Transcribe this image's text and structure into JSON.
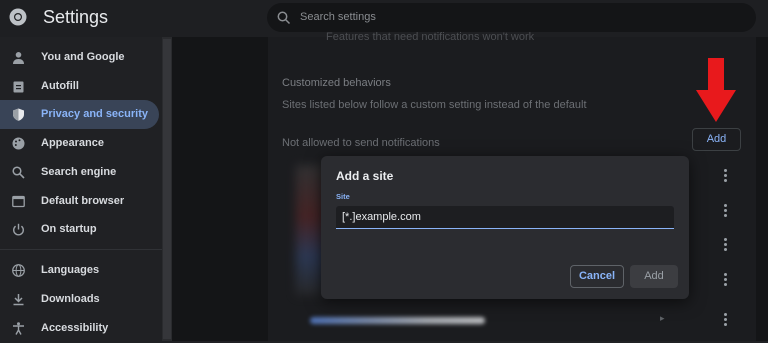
{
  "app": {
    "title": "Settings",
    "logo_icon": "chrome-logo-icon"
  },
  "search": {
    "placeholder": "Search settings"
  },
  "sidebar": {
    "items": [
      {
        "label": "You and Google",
        "icon": "person-icon"
      },
      {
        "label": "Autofill",
        "icon": "clipboard-icon"
      },
      {
        "label": "Privacy and security",
        "icon": "shield-icon",
        "active": true
      },
      {
        "label": "Appearance",
        "icon": "palette-icon"
      },
      {
        "label": "Search engine",
        "icon": "search-icon"
      },
      {
        "label": "Default browser",
        "icon": "browser-icon"
      },
      {
        "label": "On startup",
        "icon": "power-icon"
      },
      {
        "label": "Languages",
        "icon": "globe-icon"
      },
      {
        "label": "Downloads",
        "icon": "download-icon"
      },
      {
        "label": "Accessibility",
        "icon": "accessibility-icon"
      }
    ]
  },
  "content": {
    "faded_text": "Features that need notifications won't work",
    "section_title": "Customized behaviors",
    "section_desc": "Sites listed below follow a custom setting instead of the default",
    "not_allowed_label": "Not allowed to send notifications",
    "add_label": "Add",
    "annotation_color": "#e8191c"
  },
  "dialog": {
    "title": "Add a site",
    "site_label": "Site",
    "site_value": "[*.]example.com",
    "cancel_label": "Cancel",
    "add_label": "Add"
  },
  "colors": {
    "accent": "#8ab4f8",
    "active_bg": "#394457",
    "background": "#202124"
  }
}
